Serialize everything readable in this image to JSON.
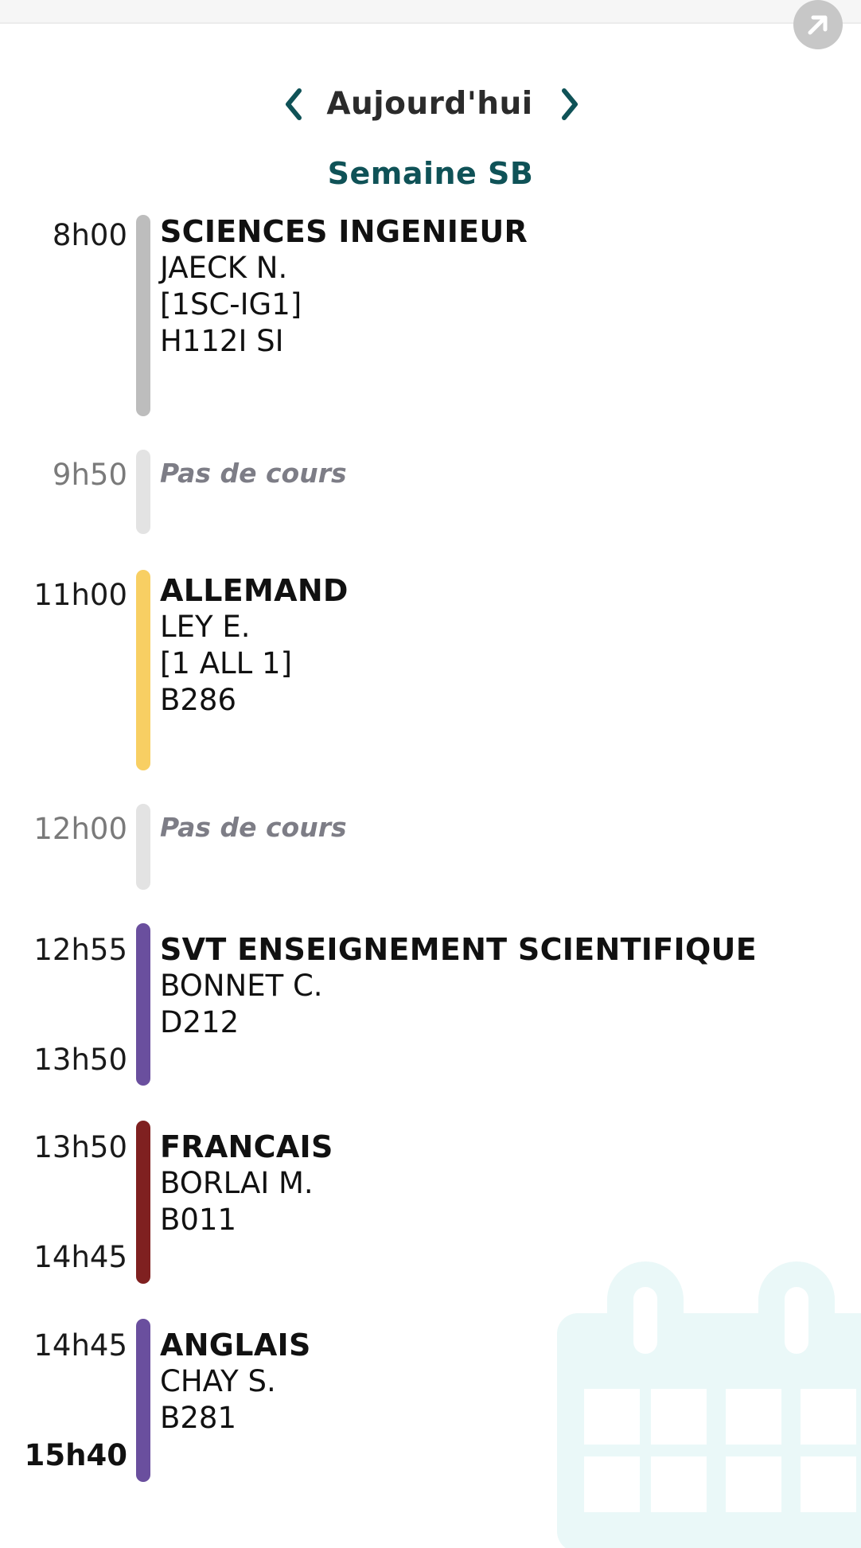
{
  "header": {
    "expand_icon": "arrow-up-right-icon",
    "prev_icon": "chevron-left-icon",
    "next_icon": "chevron-right-icon",
    "date_title": "Aujourd'hui",
    "week_label": "Semaine SB"
  },
  "colors": {
    "accent_teal": "#0f5257",
    "gray": "#bdbdbd",
    "light_gray": "#e3e3e3",
    "yellow": "#f8cf63",
    "purple": "#6a4f9e",
    "dark_red": "#7f2020",
    "watermark": "#eaf8f8"
  },
  "schedule": [
    {
      "start": "8h00",
      "subject": "SCIENCES INGENIEUR",
      "teacher": "JAECK N.",
      "group": "[1SC-IG1]",
      "room": "H112I SI"
    },
    {
      "start": "9h50",
      "label": "Pas de cours"
    },
    {
      "start": "11h00",
      "subject": "ALLEMAND",
      "teacher": "LEY E.",
      "group": "[1 ALL 1]",
      "room": "B286"
    },
    {
      "start": "12h00",
      "label": "Pas de cours"
    },
    {
      "start": "12h55",
      "end": "13h50",
      "subject": "SVT ENSEIGNEMENT SCIENTIFIQUE",
      "teacher": "BONNET C.",
      "room": "D212"
    },
    {
      "start": "13h50",
      "end": "14h45",
      "subject": "FRANCAIS",
      "teacher": "BORLAI M.",
      "room": "B011"
    },
    {
      "start": "14h45",
      "end": "15h40",
      "subject": "ANGLAIS",
      "teacher": "CHAY S.",
      "room": "B281"
    }
  ],
  "background_icon": "calendar-icon"
}
